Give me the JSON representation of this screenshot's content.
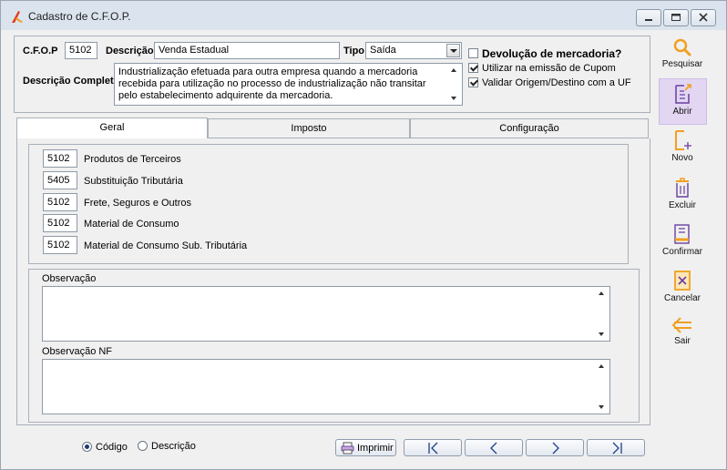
{
  "window": {
    "title": "Cadastro de C.F.O.P."
  },
  "form": {
    "cfop_label": "C.F.O.P",
    "cfop_value": "5102",
    "descricao_label": "Descrição",
    "descricao_value": "Venda Estadual",
    "tipo_label": "Tipo",
    "tipo_value": "Saída",
    "descricao_completa_label": "Descrição Completa",
    "descricao_completa_value": "Industrialização efetuada para outra empresa quando a mercadoria recebida para utilização no processo de industrialização não transitar pelo estabelecimento adquirente da mercadoria.",
    "devolucao_label": "Devolução de mercadoria?",
    "devolucao_checked": false,
    "cupom_label": "Utilizar na emissão de Cupom",
    "cupom_checked": true,
    "origem_label": "Validar Origem/Destino com a UF",
    "origem_checked": true
  },
  "tabs": [
    {
      "label": "Geral",
      "active": true
    },
    {
      "label": "Imposto",
      "active": false
    },
    {
      "label": "Configuração",
      "active": false
    }
  ],
  "geral_rows": [
    {
      "code": "5102",
      "label": "Produtos de Terceiros"
    },
    {
      "code": "5405",
      "label": "Substituição Tributária"
    },
    {
      "code": "5102",
      "label": "Frete, Seguros e Outros"
    },
    {
      "code": "5102",
      "label": "Material de Consumo"
    },
    {
      "code": "5102",
      "label": "Material de Consumo Sub. Tributária"
    }
  ],
  "observacao_label": "Observação",
  "observacao_nf_label": "Observação NF",
  "sort": {
    "codigo_label": "Código",
    "descricao_label": "Descrição",
    "selected": "Código"
  },
  "nav": {
    "imprimir_label": "Imprimir"
  },
  "sidebar": {
    "pesquisar": "Pesquisar",
    "abrir": "Abrir",
    "novo": "Novo",
    "excluir": "Excluir",
    "confirmar": "Confirmar",
    "cancelar": "Cancelar",
    "sair": "Sair"
  },
  "colors": {
    "accent_orange": "#f0a020",
    "selected_sidebar": "#e2d6f3",
    "title_bar": "#dbe4ee"
  }
}
